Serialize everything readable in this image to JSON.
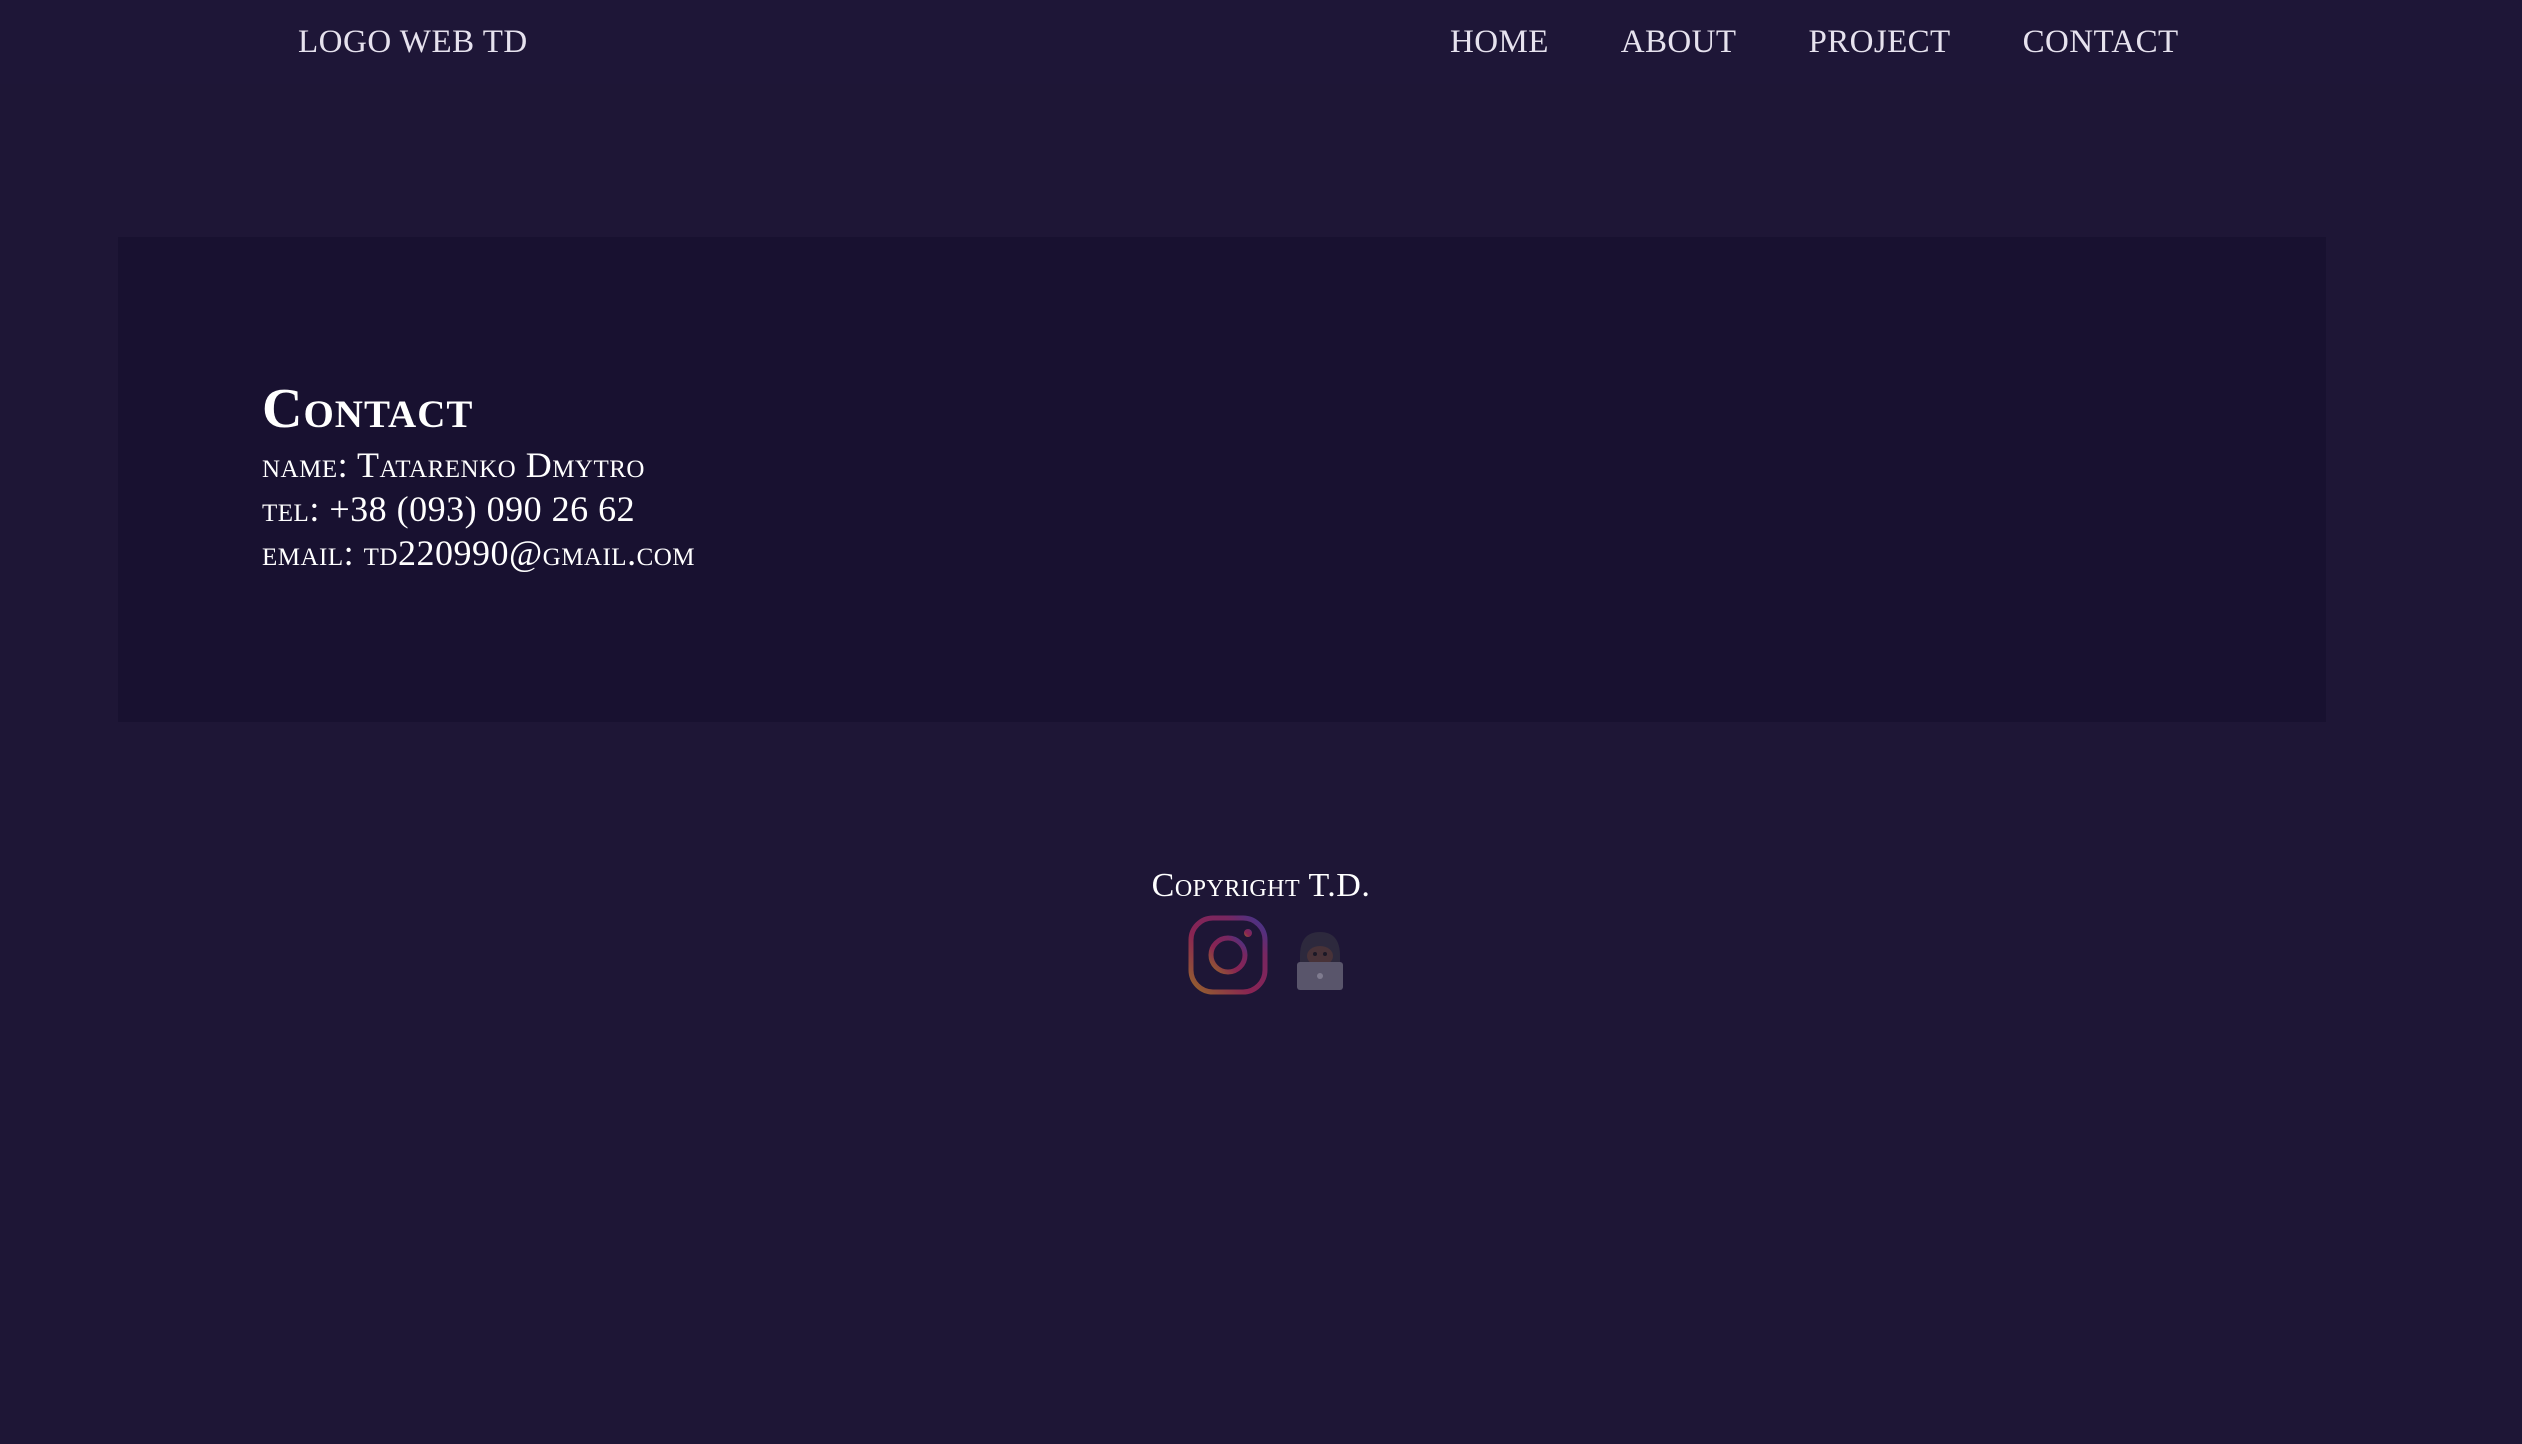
{
  "header": {
    "logo": "LOGO WEB TD",
    "nav": [
      {
        "label": "HOME"
      },
      {
        "label": "ABOUT"
      },
      {
        "label": "PROJECT"
      },
      {
        "label": "CONTACT"
      }
    ]
  },
  "contact": {
    "title": "Contact",
    "name_label": "name:",
    "name_value": "Tatarenko Dmytro",
    "tel_label": "tel:",
    "tel_value": "+38 (093) 090 26 62",
    "email_label": "email:",
    "email_value": "td220990@gmail.com"
  },
  "footer": {
    "copyright": "Copyright T.D.",
    "icons": [
      "instagram-icon",
      "hacker-laptop-icon"
    ]
  },
  "colors": {
    "background": "#1e1636",
    "panel": "#181130",
    "text": "#ffffff"
  }
}
